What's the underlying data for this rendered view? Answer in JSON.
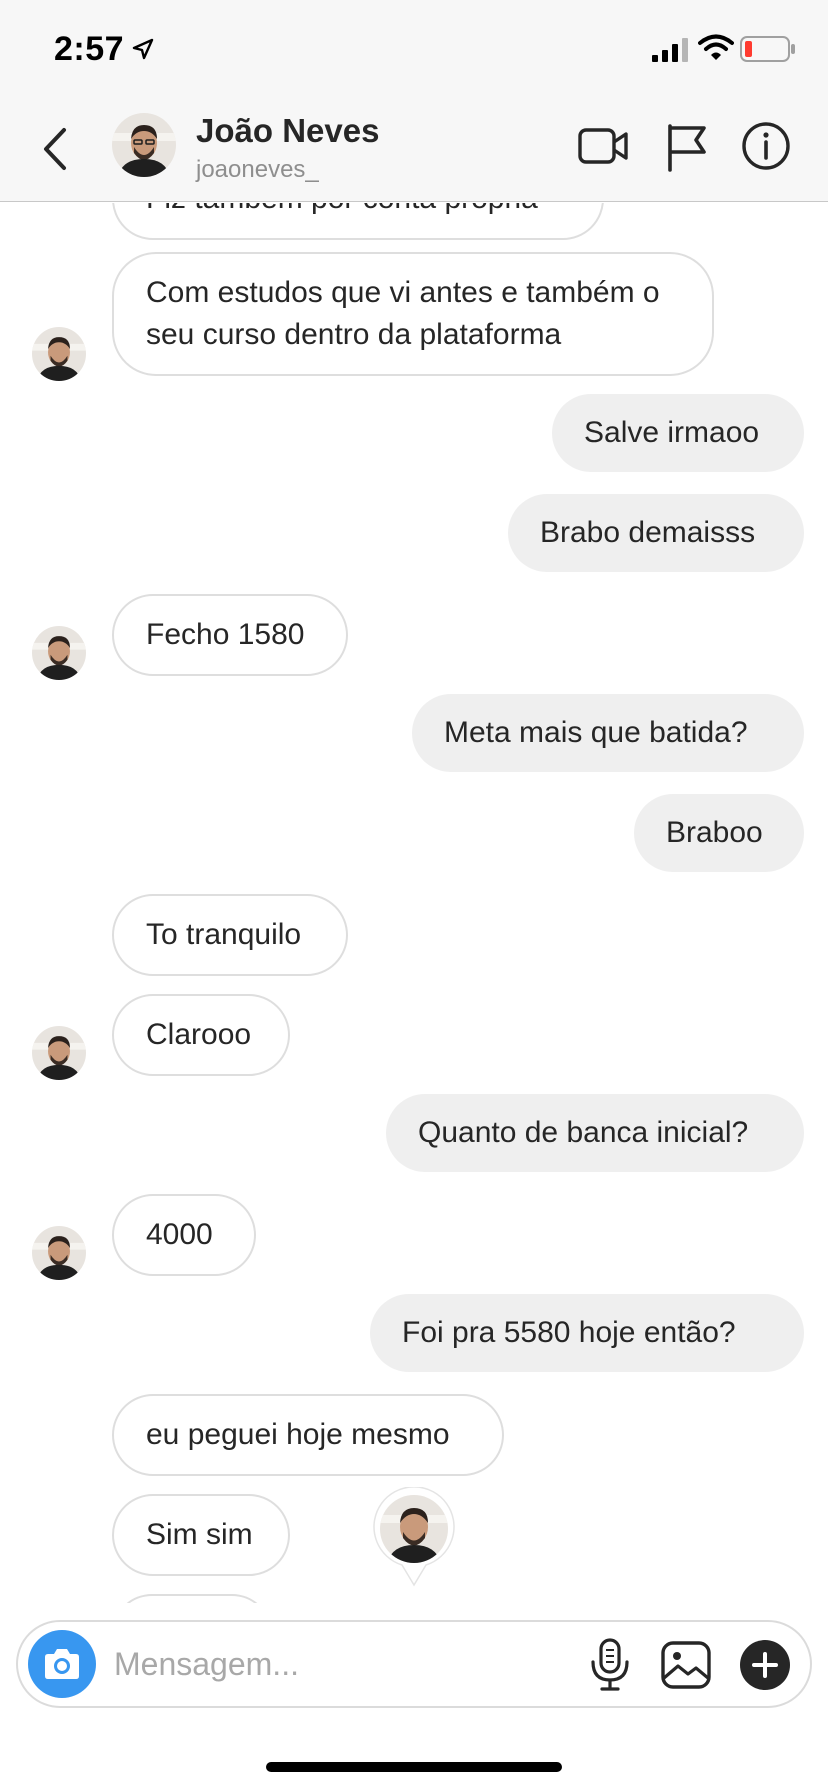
{
  "status_bar": {
    "time": "2:57"
  },
  "header": {
    "name": "João Neves",
    "username": "joaoneves_"
  },
  "messages": [
    {
      "side": "in",
      "text": "Fiz também por conta própria"
    },
    {
      "side": "in",
      "text": "Com estudos que vi antes e também o seu curso dentro da plataforma"
    },
    {
      "side": "out",
      "text": "Salve irmaoo"
    },
    {
      "side": "out",
      "text": "Brabo demaisss"
    },
    {
      "side": "in",
      "text": "Fecho 1580"
    },
    {
      "side": "out",
      "text": "Meta mais que batida?"
    },
    {
      "side": "out",
      "text": "Braboo"
    },
    {
      "side": "in",
      "text": "To tranquilo"
    },
    {
      "side": "in",
      "text": "Clarooo"
    },
    {
      "side": "out",
      "text": "Quanto de banca inicial?"
    },
    {
      "side": "in",
      "text": "4000"
    },
    {
      "side": "out",
      "text": "Foi pra 5580 hoje  então?"
    },
    {
      "side": "in",
      "text": "eu peguei hoje mesmo"
    },
    {
      "side": "in",
      "text": "Sim sim"
    }
  ],
  "composer": {
    "placeholder": "Mensagem..."
  },
  "colors": {
    "accent": "#3897f0",
    "outgoing_bubble": "#efefef",
    "incoming_border": "#dedede"
  }
}
